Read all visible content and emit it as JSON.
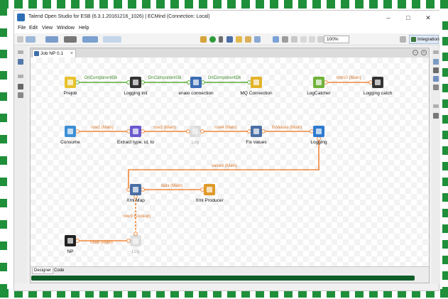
{
  "window": {
    "title": "Talend Open Studio for ESB (6.3.1.20161216_1026) | ECMind (Connection: Local)",
    "minimize": "–",
    "maximize": "□",
    "close": "✕"
  },
  "menu": [
    "File",
    "Edit",
    "View",
    "Window",
    "Help"
  ],
  "toolbar": {
    "zoom_value": "100%",
    "perspective_label": "Integration"
  },
  "editor": {
    "tab_label": "Job NP 0.1",
    "tab_close": "×",
    "bottom_tabs": [
      "Designer",
      "Code"
    ]
  },
  "components": [
    {
      "label": "Prejob",
      "icon": "prejob-icon",
      "color": "#e8c22e"
    },
    {
      "label": "Logging init",
      "icon": "java-row-icon",
      "color": "#333333"
    },
    {
      "label": "enaio connection",
      "icon": "connection-icon",
      "color": "#3b6db3"
    },
    {
      "label": "MQ Connection",
      "icon": "mq-icon",
      "color": "#e3b328"
    },
    {
      "label": "LogCatcher",
      "icon": "logcatcher-icon",
      "color": "#6fb339"
    },
    {
      "label": "Logging catch",
      "icon": "java-row-icon",
      "color": "#333333"
    },
    {
      "label": "Consume",
      "icon": "consumer-icon",
      "color": "#3d8fd6"
    },
    {
      "label": "Extract type, id, to",
      "icon": "extract-icon",
      "color": "#6a5acd"
    },
    {
      "label": "Log",
      "icon": "log-row-icon",
      "color": "#b0b0b0"
    },
    {
      "label": "Fix values",
      "icon": "map-icon",
      "color": "#4a6fa5"
    },
    {
      "label": "Logging",
      "icon": "logging-icon",
      "color": "#2e7bcf"
    },
    {
      "label": "Xml Map",
      "icon": "xml-map-icon",
      "color": "#4a6fa5"
    },
    {
      "label": "Xml Producer",
      "icon": "producer-icon",
      "color": "#e09a2b"
    },
    {
      "label": "NP",
      "icon": "np-input-icon",
      "color": "#222222"
    },
    {
      "label": "Log",
      "icon": "log-row-icon",
      "color": "#b0b0b0"
    }
  ],
  "connections": [
    {
      "label": "OnComponentOk",
      "type": "trigger",
      "color": "#5aab37"
    },
    {
      "label": "OnComponentOk",
      "type": "trigger",
      "color": "#5aab37"
    },
    {
      "label": "OnComponentOk",
      "type": "trigger",
      "color": "#5aab37"
    },
    {
      "label": "row10 (Main)",
      "type": "row",
      "color": "#f0883a"
    },
    {
      "label": "row1 (Main)",
      "type": "row",
      "color": "#f0883a"
    },
    {
      "label": "row2 (Main)",
      "type": "row",
      "color": "#f0883a"
    },
    {
      "label": "row4 (Main)",
      "type": "row",
      "color": "#f0883a"
    },
    {
      "label": "fixValues (Main)",
      "type": "row",
      "color": "#f0883a"
    },
    {
      "label": "values (Main)",
      "type": "row",
      "color": "#f0883a"
    },
    {
      "label": "data (Main)",
      "type": "row",
      "color": "#f0883a"
    },
    {
      "label": "row9 (Lookup)",
      "type": "lookup",
      "color": "#f0883a"
    },
    {
      "label": "row8 (Main)",
      "type": "row",
      "color": "#f0883a"
    }
  ]
}
